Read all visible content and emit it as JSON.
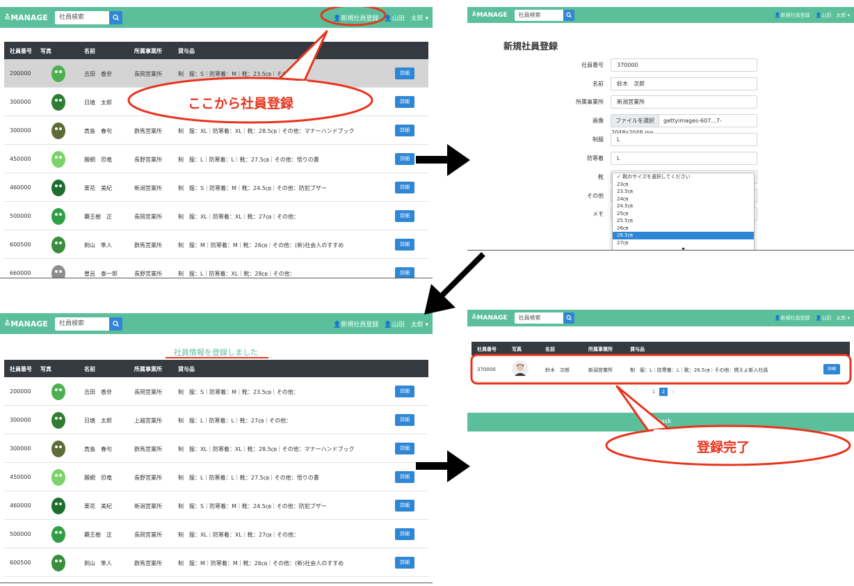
{
  "app": {
    "brand": "≛MANAGE",
    "search_placeholder": "社員検索",
    "nav_register": "新規社員登録",
    "nav_user": "山田　太郎 ▾"
  },
  "table": {
    "headers": [
      "社員番号",
      "写真",
      "名前",
      "所属事業所",
      "貸与品"
    ],
    "detail_label": "詳細"
  },
  "list_rows": [
    {
      "id": "200000",
      "name": "吉田　香奈",
      "office": "長岡営業所",
      "items": "制　服：S｜防寒着：M｜靴：23.5㎝｜その他："
    },
    {
      "id": "300000",
      "name": "日填　太郎",
      "office": "上越営業所",
      "items": "制　服：L｜防寒着：L｜靴：27㎝｜その他："
    },
    {
      "id": "300000",
      "name": "真島　春句",
      "office": "群馬営業所",
      "items": "制　服：XL｜防寒着：XL｜靴：28.5㎝｜その他：マナーハンドブック"
    },
    {
      "id": "450000",
      "name": "勝網　恐竜",
      "office": "長野営業所",
      "items": "制　服：L｜防寒着：L｜靴：27.5㎝｜その他：悟りの書"
    },
    {
      "id": "460000",
      "name": "栗花　美紀",
      "office": "新潟営業所",
      "items": "制　服：S｜防寒着：M｜靴：24.5㎝｜その他：防犯ブザー"
    },
    {
      "id": "500000",
      "name": "覇王樹　正",
      "office": "長岡営業所",
      "items": "制　服：XL｜防寒着：XL｜靴：27㎝｜その他："
    },
    {
      "id": "600500",
      "name": "剣山　隼人",
      "office": "群馬営業所",
      "items": "制　服：M｜防寒着：M｜靴：26㎝｜その他：(新)社会人のすすめ"
    },
    {
      "id": "660000",
      "name": "曽呂　泰一郎",
      "office": "長野営業所",
      "items": "制　服：L｜防寒着：XL｜靴：28㎝｜その他："
    }
  ],
  "form": {
    "title": "新規社員登録",
    "fields": [
      {
        "label": "社員番号",
        "value": "370000"
      },
      {
        "label": "名前",
        "value": "鈴木　次郎"
      },
      {
        "label": "所属事業所",
        "value": "新潟営業所"
      },
      {
        "label": "画像",
        "value": "gettyimages-607...7-2048x2048.jpg",
        "button": "ファイルを選択"
      },
      {
        "label": "制服",
        "value": "L"
      },
      {
        "label": "防寒着",
        "value": "L"
      },
      {
        "label": "靴",
        "value": ""
      },
      {
        "label": "その他",
        "value": ""
      },
      {
        "label": "メモ",
        "value": ""
      }
    ],
    "shoe_options": [
      "✓ 靴のサイズを選択してください",
      "23㎝",
      "23.5㎝",
      "24㎝",
      "24.5㎝",
      "25㎝",
      "25.5㎝",
      "26㎝",
      "26.5㎝",
      "27㎝"
    ],
    "shoe_selected": "26.5㎝"
  },
  "flash_message": "社員情報を登録しました",
  "result_row": {
    "id": "370000",
    "name": "鈴木　次郎",
    "office": "新潟営業所",
    "items": "制　服：L｜防寒着：L｜靴：26.5㎝｜その他：燃えよ新入社員"
  },
  "pagination": [
    "1",
    "2",
    "›"
  ],
  "footer": "© task",
  "callouts": {
    "register_here": "ここから社員登録",
    "done": "登録完了"
  },
  "colors": {
    "navbar": "#5bbf9c",
    "primary": "#2f86d4",
    "header": "#343a40",
    "callout": "#e8331b",
    "flash": "#5bbf9c"
  }
}
